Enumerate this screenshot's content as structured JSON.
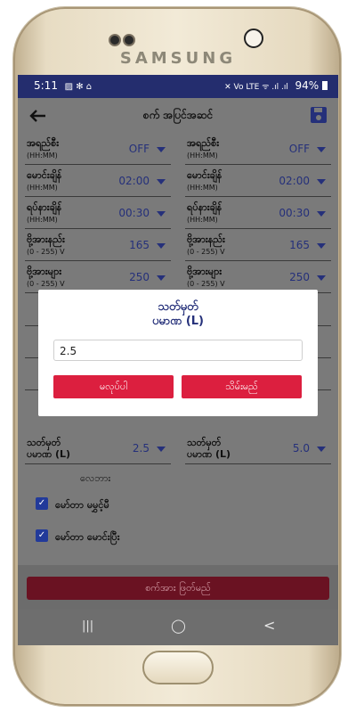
{
  "device": {
    "brand": "SAMSUNG"
  },
  "status_bar": {
    "time": "5:11",
    "battery": "94%",
    "left_icons": "▨ ✻ ⌂",
    "right_icons": "✕ Vo LTE ᯤ .ıl .ıl"
  },
  "app_bar": {
    "title": "စက် အပြင်အဆင်",
    "back_icon": "arrow-left-icon",
    "save_icon": "save-icon"
  },
  "settings_rows": [
    {
      "left": {
        "label": "အရည်စီး",
        "sub": "(HH:MM)",
        "value": "OFF"
      },
      "right": {
        "label": "အရည်စီး",
        "sub": "(HH:MM)",
        "value": "OFF"
      }
    },
    {
      "left": {
        "label": "မောင်းချိန်",
        "sub": "(HH:MM)",
        "value": "02:00"
      },
      "right": {
        "label": "မောင်းချိန်",
        "sub": "(HH:MM)",
        "value": "02:00"
      }
    },
    {
      "left": {
        "label": "ရပ်နားချိန်",
        "sub": "(HH:MM)",
        "value": "00:30"
      },
      "right": {
        "label": "ရပ်နားချိန်",
        "sub": "(HH:MM)",
        "value": "00:30"
      }
    },
    {
      "left": {
        "label": "ဗို့အားနည်း",
        "sub": "(0 - 255) V",
        "value": "165"
      },
      "right": {
        "label": "ဗို့အားနည်း",
        "sub": "(0 - 255) V",
        "value": "165"
      }
    },
    {
      "left": {
        "label": "ဗို့အားများ",
        "sub": "(0 - 255) V",
        "value": "250"
      },
      "right": {
        "label": "ဗို့အားများ",
        "sub": "(0 - 255) V",
        "value": "250"
      }
    }
  ],
  "last_row": {
    "left": {
      "label": "သတ်မှတ်",
      "sub": "ပမာဏ (L)",
      "value": "2.5"
    },
    "right": {
      "label": "သတ်မှတ်",
      "sub": "ပမာဏ (L)",
      "value": "5.0"
    }
  },
  "section_label": "လေဘား",
  "checkboxes": [
    {
      "label": "မော်တာ မမွှင့်မီ",
      "checked": true
    },
    {
      "label": "မော်တာ မောင်းပြီး",
      "checked": true
    }
  ],
  "save_button": {
    "label": "စက်အား ဖြတ်မည်"
  },
  "dialog": {
    "title_line1": "သတ်မှတ်",
    "title_line2": "ပမာဏ (L)",
    "input_value": "2.5",
    "cancel_label": "မလုပ်ပါ",
    "ok_label": "သိမ်းမည်"
  },
  "nav": {
    "recents": "|||",
    "home": "◯",
    "back": "<"
  },
  "colors": {
    "status_bar": "#242d6e",
    "accent": "#25307a",
    "danger": "#dc1f3f",
    "overlay": "#7a7a7a"
  }
}
